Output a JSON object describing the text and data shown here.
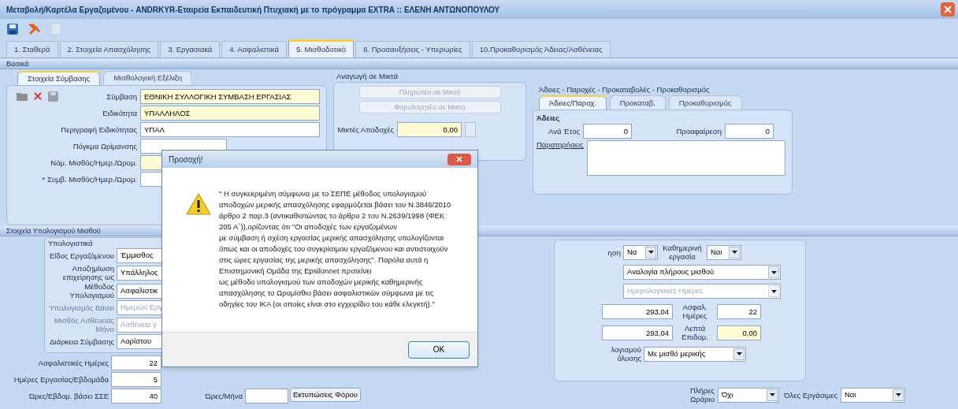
{
  "window": {
    "title": "Μεταβολή/Καρτέλα Εργαζομένου - ANDRKYR-Εταιρεία Εκπαιδευτική Πτυχιακή με το πρόγραμμα EXTRA :: ΕΛΕΝΗ ΑΝΤΩΝΟΠΟΥΛΟΥ"
  },
  "tabs": [
    {
      "label": "1. Σταθερά",
      "selected": false
    },
    {
      "label": "2. Στοιχεία Απασχόλησης",
      "selected": false
    },
    {
      "label": "3. Εργασιακά",
      "selected": false
    },
    {
      "label": "4. Ασφαλιστικά",
      "selected": false
    },
    {
      "label": "5. Μισθοδοτικό",
      "selected": true
    },
    {
      "label": "6. Προσαυξήσεις - Υπερωρίες",
      "selected": false
    },
    {
      "label": "10.Προκαθορισμός Άδειας/Ασθένειας",
      "selected": false
    }
  ],
  "basic_section": {
    "title": "Βασικά"
  },
  "contract_panel": {
    "tabs": [
      {
        "label": "Στοιχεία Σύμβασης",
        "selected": true
      },
      {
        "label": "Μισθολογική Εξέλιξη",
        "selected": false
      }
    ],
    "fields": [
      {
        "label": "Σύμβαση",
        "value": "ΕΘΝΙΚΗ ΣΥΛΛΟΓΙΚΗ ΣΥΜΒΑΣΗ ΕΡΓΑΣΙΑΣ",
        "highlighted": true
      },
      {
        "label": "Ειδικότητα",
        "value": "ΥΠΑΛΛΗΛΟΣ",
        "highlighted": true
      },
      {
        "label": "Περιγραφή Ειδικότητας",
        "value": "ΥΠΑΛ",
        "highlighted": false
      },
      {
        "label": "Πόγκμα Ωρίμανσης",
        "highlighted": false
      },
      {
        "label": "Νόμ. Μισθός/Ημερ./Ωρομ.",
        "highlighted": true
      },
      {
        "label": "* Συμβ. Μισθός/Ημερ./Ωρομ.",
        "highlighted": false
      }
    ]
  },
  "gross_panel": {
    "title": "Αναγωγή σε Μικτά",
    "buttons": [
      {
        "label": "Πληρωτέο σε Μικτό",
        "disabled": true
      },
      {
        "label": "Φορολογητέο σε Μικτό",
        "disabled": true
      }
    ],
    "gross_label": "Μικτές Αποδοχές",
    "gross_value": "0,00"
  },
  "leave_panel": {
    "title": "Άδειες - Παροχές - Προκαταβολές - Προκαθορισμός",
    "tabs": [
      {
        "label": "Άδειες/Παροχ.",
        "selected": true
      },
      {
        "label": "Προκαταβ.",
        "selected": false
      },
      {
        "label": "Προκαθορισμός",
        "selected": false
      }
    ],
    "group": "Άδειες",
    "per_year_label": "Ανά Έτος",
    "per_year": "0",
    "deduction_label": "Προαφαίρεση",
    "deduction": "0",
    "notes_label": "Παρατηρήσεις"
  },
  "calc_section": {
    "title": "Στοιχεία Υπολογισμού Μισθού"
  },
  "calc_panel": {
    "group": "Υπολογιστικά",
    "rows": [
      {
        "kind": "select",
        "label": "Είδος Εργαζόμενου",
        "value": "Έμμισθος",
        "disabled": false
      },
      {
        "kind": "select",
        "label": "Αποζημίωση επιχείρησης ως",
        "value": "Υπάλληλος",
        "disabled": false
      },
      {
        "kind": "select",
        "label": "Μέθοδος Υπολογισμού",
        "value": "Ασφαλιστικ",
        "disabled": false
      },
      {
        "kind": "select",
        "label": "Υπολογισμός Βάσει",
        "value": "Ημερών Εργ",
        "disabled": true
      },
      {
        "kind": "select",
        "label": "Μισθός Ασθένειας Μήνα",
        "value": "Ασθένεια γ",
        "disabled": true
      },
      {
        "kind": "select",
        "label": "Διάρκεια Σύμβασης",
        "value": "Αορίστου",
        "disabled": false
      }
    ],
    "numbers": [
      {
        "label": "Ασφαλιστικές Ημέρες",
        "value": "22"
      },
      {
        "label": "Ημέρες Εργασίας/Εβδομάδα",
        "value": "5"
      },
      {
        "label": "Ώρες/Εβδομ. βάσει ΣΣΕ",
        "value": "40"
      }
    ],
    "hours_month_label": "Ώρες/Μήνα",
    "print_button": "Εκτυπώσεις Φόρου"
  },
  "pay_panel": {
    "cut_label": "ηση",
    "cut_value": "Να",
    "daily_label": "Καθημερινή εργασία",
    "daily_value": "Ναι",
    "selects": [
      {
        "value": "Αναλογία πλήρους μισθού",
        "disabled": false
      },
      {
        "value": "Ημερολογιακές Ημέρες",
        "disabled": true
      }
    ],
    "amount_1": "293,04",
    "insured_days_label": "Ασφαλ. Ημέρες",
    "insured_days": "22",
    "amount_2": "293,04",
    "minutes_label": "Λεπτά Επιδομ.",
    "minutes": "0,00",
    "method_label": "λογισμού όλυσης",
    "method_value": "Με μισθό μερικής"
  },
  "bottom_row": {
    "full_time_label": "Πλήρες Ωράριο",
    "full_time": "Όχι",
    "all_workdays_label": "Όλες Εργάσιμες",
    "all_workdays": "Ναι"
  },
  "dialog": {
    "title": "Προσοχή!",
    "message": "\" Η συγκεκριμένη σύμφωνα με το ΣΕΠΕ μέθοδος υπολογισμού αποδοχών μερικής απασχόλησης εφαρμόζεται βάσει του Ν.3846/2010 άρθρο 2 παρ.3 (αντικαθιστώντας το άρθρο 2 του Ν.2639/1998 (ΦΕΚ 205 Α΄)),ορίζοντας ότι \"Οι αποδοχές των εργαζομένων\nμε σύμβαση ή σχέση εργασίας μερικής απασχόλησης υπολογίζονται όπως και οι αποδοχές του συγκρίσιμου εργαζόμενου και αντιστοιχούν στις ώρες εργασίας της μερικής απασχόλησης\". Παρόλα αυτά η Επιστημονική Ομάδα της Epsilonnet προτείνει\nως μέθοδο υπολογισμού των αποδοχών μερικής καθημερινής απασχόλησης το Ωρομίσθιο βάσει ασφαλιστικών σύμφωνα με τις οδηγίες του ΙΚΑ (οι οποίες είναι στο εγχειρίδιο του κάθε ελεγκτή).\"",
    "ok_button": "OK"
  }
}
